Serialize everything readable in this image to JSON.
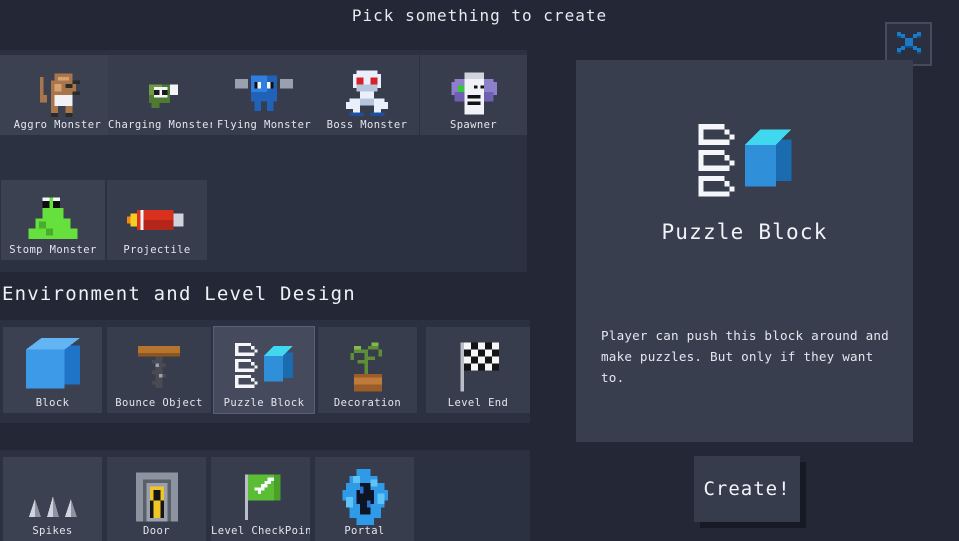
{
  "header": {
    "title": "Pick something to create",
    "close_icon": "close-x-icon"
  },
  "colors": {
    "background": "#242836",
    "panel": "#2c3142",
    "tile": "#3b4150",
    "tile_selected": "#454b5c",
    "detail_panel": "#383e4d",
    "text": "#e8eaf0",
    "accent_blue": "#1d7fd4",
    "close_x": "#1f6fae"
  },
  "sections": [
    {
      "heading": "",
      "name": "monsters-section",
      "rows": [
        [
          {
            "label": "Aggro Monster",
            "icon": "aggro-monster-icon",
            "selected": false
          },
          {
            "label": "Charging Monster",
            "icon": "charging-monster-icon",
            "selected": false
          },
          {
            "label": "Flying Monster",
            "icon": "flying-monster-icon",
            "selected": false
          },
          {
            "label": "Boss Monster",
            "icon": "boss-monster-icon",
            "selected": false
          },
          {
            "label": "Spawner",
            "icon": "spawner-icon",
            "selected": false
          }
        ],
        [
          {
            "label": "Stomp Monster",
            "icon": "stomp-monster-icon",
            "selected": false
          },
          {
            "label": "Projectile",
            "icon": "projectile-icon",
            "selected": false
          }
        ]
      ]
    },
    {
      "heading": "Environment and Level Design",
      "name": "environment-section",
      "rows": [
        [
          {
            "label": "Block",
            "icon": "block-icon",
            "selected": false
          },
          {
            "label": "Bounce Object",
            "icon": "bounce-object-icon",
            "selected": false
          },
          {
            "label": "Puzzle Block",
            "icon": "puzzle-block-icon",
            "selected": true
          },
          {
            "label": "Decoration",
            "icon": "decoration-icon",
            "selected": false
          },
          {
            "label": "Level End",
            "icon": "level-end-icon",
            "selected": false
          }
        ],
        [
          {
            "label": "Spikes",
            "icon": "spikes-icon",
            "selected": false
          },
          {
            "label": "Door",
            "icon": "door-icon",
            "selected": false
          },
          {
            "label": "Level CheckPoint",
            "icon": "level-checkpoint-icon",
            "selected": false
          },
          {
            "label": "Portal",
            "icon": "portal-icon",
            "selected": false
          }
        ]
      ]
    }
  ],
  "detail": {
    "icon": "puzzle-block-icon",
    "name": "Puzzle Block",
    "description": "Player can push this block around and make puzzles. But only if they want to."
  },
  "create_button": {
    "label": "Create!"
  }
}
